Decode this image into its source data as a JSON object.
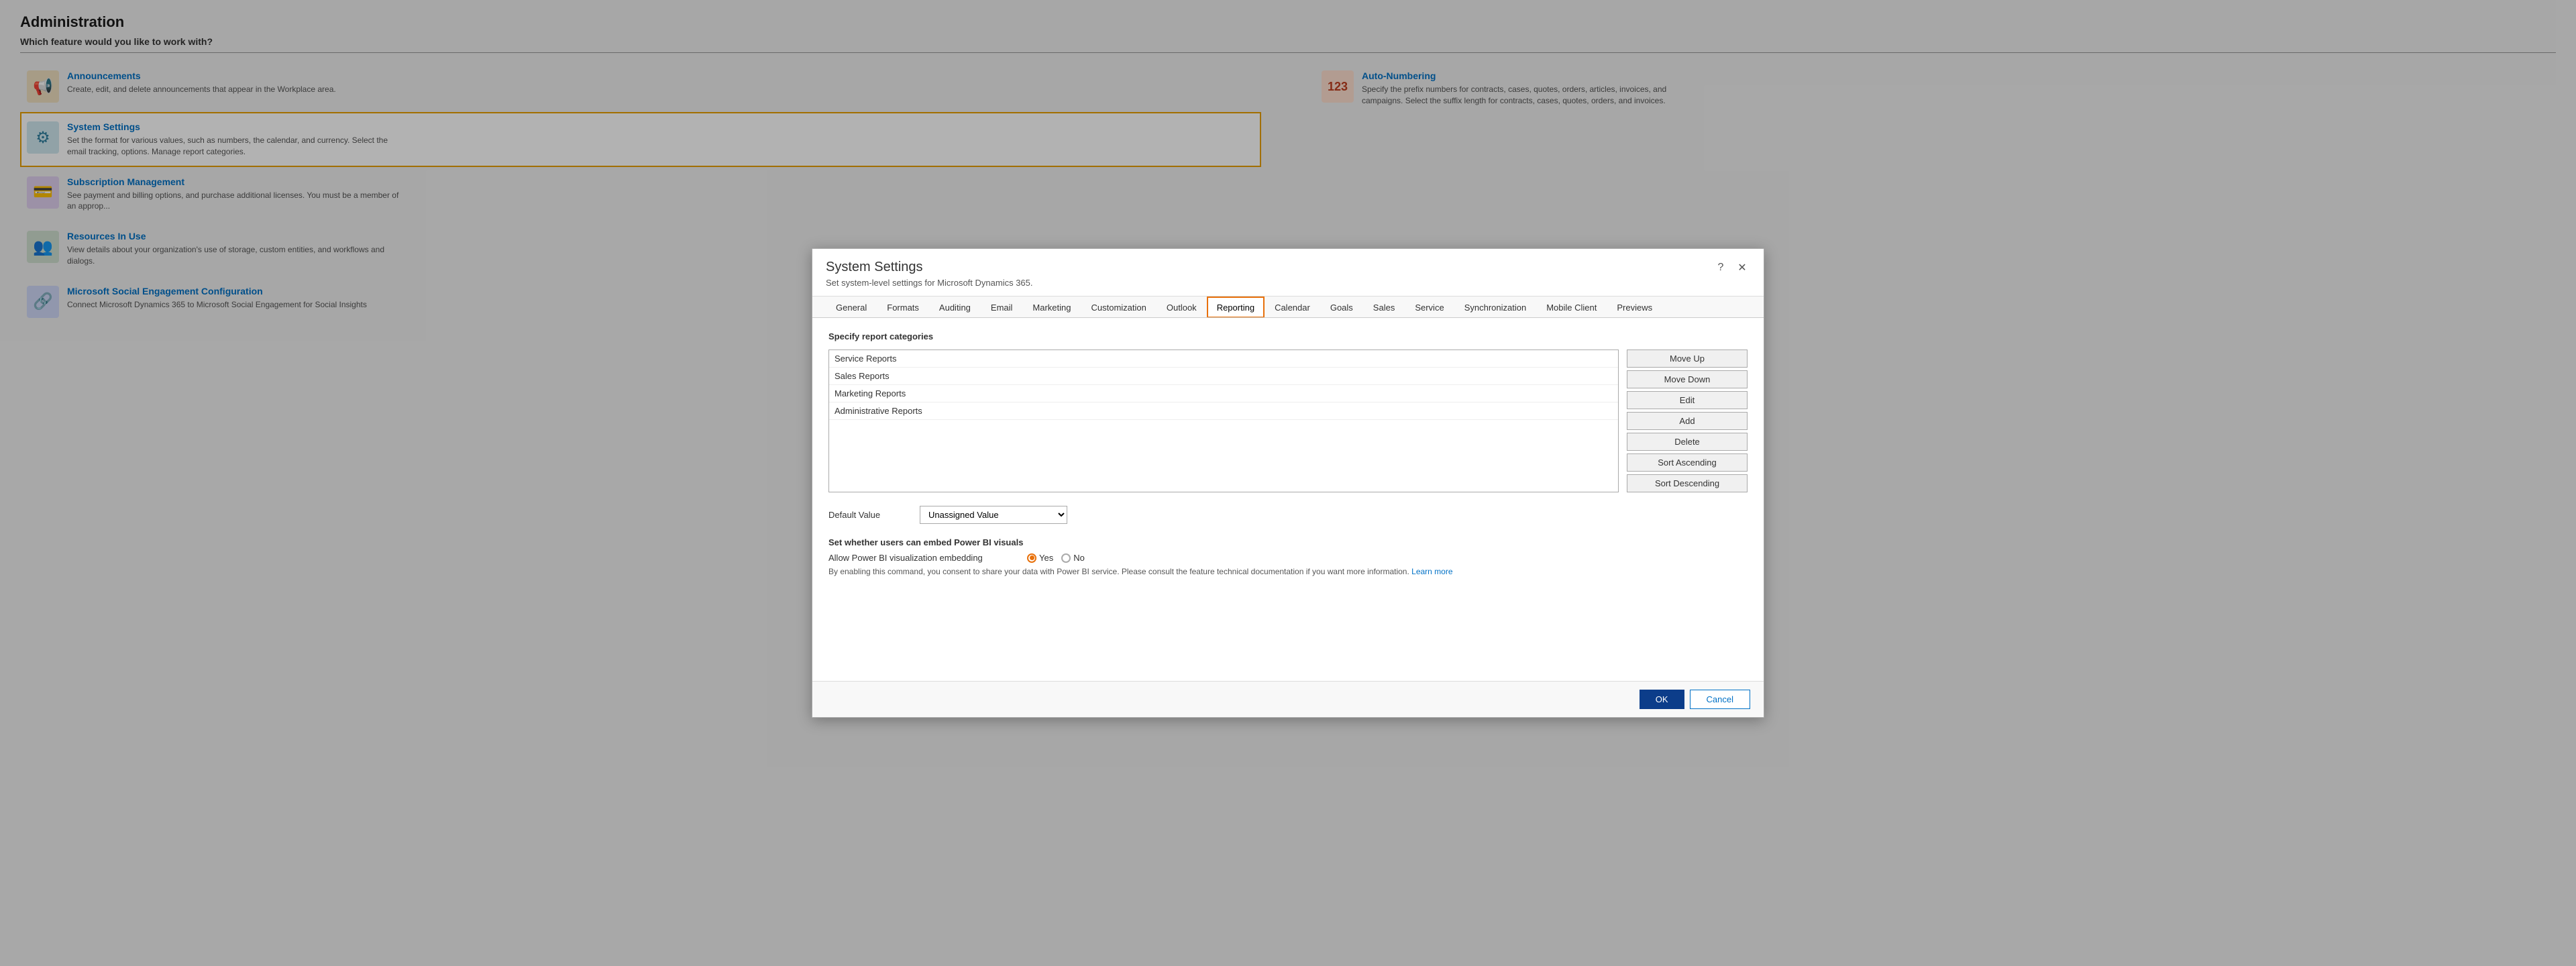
{
  "page": {
    "title": "Administration",
    "subtitle": "Which feature would you like to work with?"
  },
  "admin_items": [
    {
      "id": "announcements",
      "name": "Announcements",
      "description": "Create, edit, and delete announcements that appear in the Workplace area.",
      "icon": "📢",
      "icon_type": "announce",
      "highlighted": false
    },
    {
      "id": "system-settings",
      "name": "System Settings",
      "description": "Set the format for various values, such as numbers, the calendar, and currency. Select the email tracking, options. Manage report categories.",
      "icon": "⚙",
      "icon_type": "gear",
      "highlighted": true
    },
    {
      "id": "subscription",
      "name": "Subscription Management",
      "description": "See payment and billing options, and purchase additional licenses. You must be a member of an approp...",
      "icon": "💳",
      "icon_type": "card",
      "highlighted": false
    },
    {
      "id": "resources",
      "name": "Resources In Use",
      "description": "View details about your organization's use of storage, custom entities, and workflows and dialogs.",
      "icon": "👥",
      "icon_type": "people",
      "highlighted": false
    },
    {
      "id": "social",
      "name": "Microsoft Social Engagement Configuration",
      "description": "Connect Microsoft Dynamics 365 to Microsoft Social Engagement for Social Insights",
      "icon": "🔗",
      "icon_type": "social",
      "highlighted": false
    }
  ],
  "admin_items_right": [
    {
      "id": "auto-numbering",
      "name": "Auto-Numbering",
      "description": "Specify the prefix numbers for contracts, cases, quotes, orders, articles, invoices, and campaigns. Select the suffix length for contracts, cases, quotes, orders, and invoices.",
      "icon": "123",
      "icon_type": "autonumber"
    }
  ],
  "modal": {
    "title": "System Settings",
    "subtitle": "Set system-level settings for Microsoft Dynamics 365.",
    "help_label": "?",
    "close_label": "✕",
    "tabs": [
      {
        "id": "general",
        "label": "General"
      },
      {
        "id": "formats",
        "label": "Formats"
      },
      {
        "id": "auditing",
        "label": "Auditing"
      },
      {
        "id": "email",
        "label": "Email"
      },
      {
        "id": "marketing",
        "label": "Marketing"
      },
      {
        "id": "customization",
        "label": "Customization"
      },
      {
        "id": "outlook",
        "label": "Outlook"
      },
      {
        "id": "reporting",
        "label": "Reporting",
        "active": true
      },
      {
        "id": "calendar",
        "label": "Calendar"
      },
      {
        "id": "goals",
        "label": "Goals"
      },
      {
        "id": "sales",
        "label": "Sales"
      },
      {
        "id": "service",
        "label": "Service"
      },
      {
        "id": "synchronization",
        "label": "Synchronization"
      },
      {
        "id": "mobile-client",
        "label": "Mobile Client"
      },
      {
        "id": "previews",
        "label": "Previews"
      }
    ],
    "reporting_tab": {
      "section_title": "Specify report categories",
      "report_items": [
        {
          "id": "service-reports",
          "label": "Service Reports"
        },
        {
          "id": "sales-reports",
          "label": "Sales Reports"
        },
        {
          "id": "marketing-reports",
          "label": "Marketing Reports"
        },
        {
          "id": "admin-reports",
          "label": "Administrative Reports"
        }
      ],
      "buttons": [
        {
          "id": "move-up",
          "label": "Move Up"
        },
        {
          "id": "move-down",
          "label": "Move Down"
        },
        {
          "id": "edit",
          "label": "Edit"
        },
        {
          "id": "add",
          "label": "Add"
        },
        {
          "id": "delete",
          "label": "Delete"
        },
        {
          "id": "sort-ascending",
          "label": "Sort Ascending"
        },
        {
          "id": "sort-descending",
          "label": "Sort Descending"
        }
      ],
      "default_value_label": "Default Value",
      "default_value_option": "Unassigned Value",
      "powerbi_section_title": "Set whether users can embed Power BI visuals",
      "powerbi_label": "Allow Power BI visualization embedding",
      "powerbi_yes": "Yes",
      "powerbi_no": "No",
      "powerbi_note": "By enabling this command, you consent to share your data with Power BI service. Please consult the feature technical documentation if you want more information.",
      "learn_more": "Learn more"
    },
    "footer": {
      "ok_label": "OK",
      "cancel_label": "Cancel"
    }
  }
}
